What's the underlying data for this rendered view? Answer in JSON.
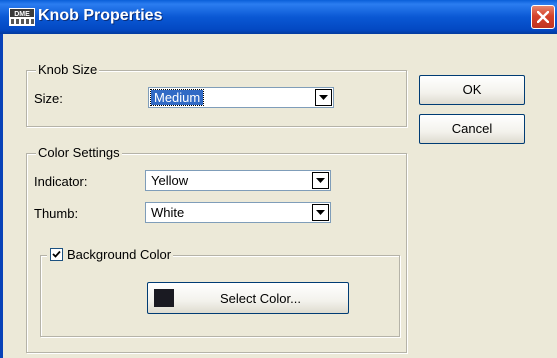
{
  "window": {
    "title": "Knob Properties",
    "app_icon": "dme-app-icon"
  },
  "knob_size": {
    "legend": "Knob Size",
    "size_label": "Size:",
    "size_value": "Medium"
  },
  "color_settings": {
    "legend": "Color Settings",
    "indicator_label": "Indicator:",
    "indicator_value": "Yellow",
    "thumb_label": "Thumb:",
    "thumb_value": "White",
    "background_label": "Background Color",
    "background_checked": true,
    "select_color_label": "Select Color...",
    "swatch_color": "#1a1a22"
  },
  "buttons": {
    "ok_label": "OK",
    "cancel_label": "Cancel"
  },
  "icons": {
    "dropdown": "chevron-down-icon",
    "close": "close-icon",
    "check": "check-icon"
  }
}
